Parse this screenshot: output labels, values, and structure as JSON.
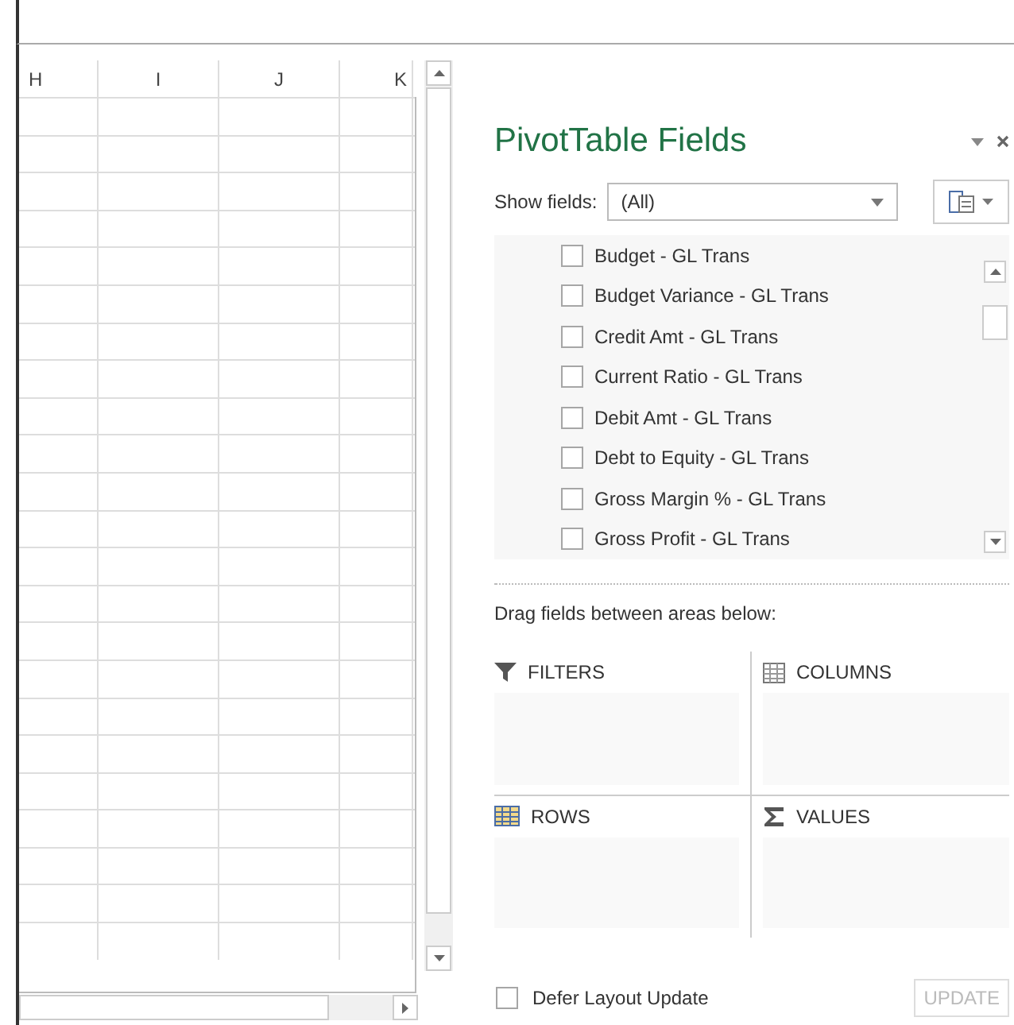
{
  "sheet": {
    "columns": [
      "H",
      "I",
      "J",
      "K"
    ]
  },
  "panel": {
    "title": "PivotTable Fields",
    "show_fields_label": "Show fields:",
    "show_fields_value": "(All)",
    "fields": [
      {
        "label": "Budget - GL Trans",
        "checked": false
      },
      {
        "label": "Budget Variance - GL Trans",
        "checked": false
      },
      {
        "label": "Credit Amt - GL Trans",
        "checked": false
      },
      {
        "label": "Current Ratio - GL Trans",
        "checked": false
      },
      {
        "label": "Debit Amt - GL Trans",
        "checked": false
      },
      {
        "label": "Debt to Equity - GL Trans",
        "checked": false
      },
      {
        "label": "Gross Margin % - GL Trans",
        "checked": false
      },
      {
        "label": "Gross Profit - GL Trans",
        "checked": false
      }
    ],
    "drag_hint": "Drag fields between areas below:",
    "areas": [
      {
        "kind": "filters",
        "label": "FILTERS"
      },
      {
        "kind": "columns",
        "label": "COLUMNS"
      },
      {
        "kind": "rows",
        "label": "ROWS"
      },
      {
        "kind": "values",
        "label": "VALUES"
      }
    ],
    "defer": {
      "label": "Defer Layout Update",
      "checked": false
    },
    "update_button": {
      "label": "UPDATE",
      "disabled": true
    }
  }
}
